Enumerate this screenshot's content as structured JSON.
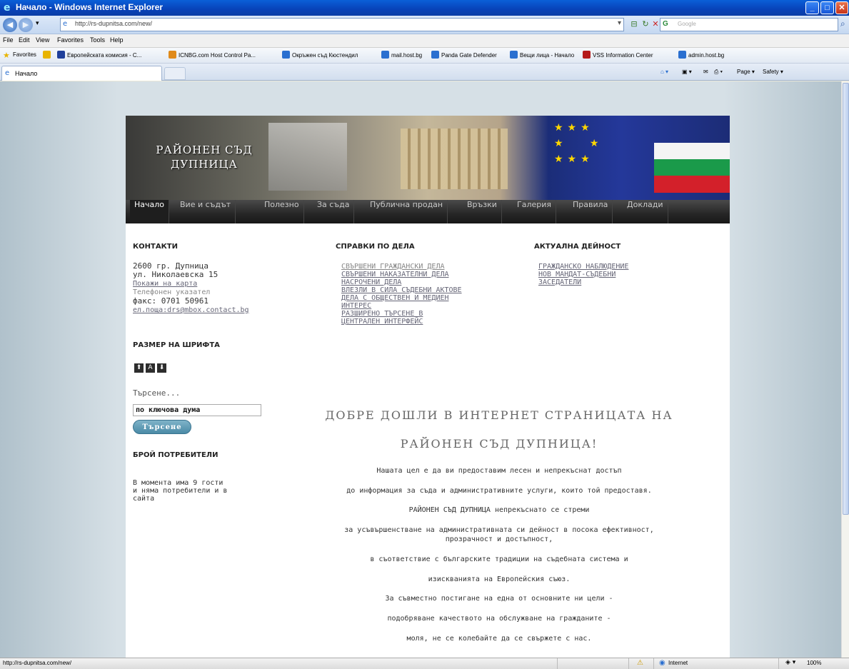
{
  "window": {
    "title": "Начало - Windows Internet Explorer",
    "buttons": {
      "minimize": "_",
      "maximize": "□",
      "close": "✕"
    }
  },
  "addressbar": {
    "url": "http://rs-dupnitsa.com/new/",
    "search_placeholder": "Google",
    "search_logo": "G"
  },
  "menubar": [
    "File",
    "Edit",
    "View",
    "Favorites",
    "Tools",
    "Help"
  ],
  "favoritesbar": {
    "label": "Favorites",
    "items": [
      {
        "label": "Европейската комисия - С...",
        "icon_color": "#1f3f9a"
      },
      {
        "label": "ICNBG.com Host Control Pa...",
        "icon_color": "#e08a1a"
      },
      {
        "label": "Окръжен съд Кюстендил",
        "icon_color": "#2a6fd0"
      },
      {
        "label": "mail.host.bg",
        "icon_color": "#2a6fd0"
      },
      {
        "label": "Panda Gate Defender",
        "icon_color": "#2a6fd0"
      },
      {
        "label": "Вещи лица - Начало",
        "icon_color": "#2a6fd0"
      },
      {
        "label": "VSS Information Center",
        "icon_color": "#b51a1a"
      },
      {
        "label": "admin.host.bg",
        "icon_color": "#2a6fd0"
      }
    ]
  },
  "tabs": {
    "active": "Начало",
    "commands": [
      "Page ▾",
      "Safety ▾"
    ]
  },
  "site": {
    "court_title": "РАЙОНЕН СЪД ДУПНИЦА",
    "nav": [
      "Начало",
      "Вие и съдът",
      "Полезно",
      "За съда",
      "Публична продан",
      "Връзки",
      "Галерия",
      "Правила",
      "Доклади"
    ],
    "contacts": {
      "heading": "КОНТАКТИ",
      "lines": [
        "2600 гр. Дупница",
        "ул. Николаевска 15"
      ],
      "map_link": "Покажи на карта",
      "phone_link": "Телефонен указател",
      "fax": "факс: 0701 50961",
      "email": "ел.поща:drs@mbox.contact.bg"
    },
    "font_size": {
      "heading": "РАЗМЕР НА ШРИФТА",
      "buttons": [
        "⬆",
        "A",
        "⬇"
      ]
    },
    "search": {
      "label": "Търсене...",
      "value": "по ключова дума",
      "button": "Търсене"
    },
    "users": {
      "heading": "БРОЙ ПОТРЕБИТЕЛИ",
      "lines": [
        "В момента има 9  гости",
        "и няма потребители и в",
        "сайта"
      ]
    },
    "cases": {
      "heading": "СПРАВКИ ПО ДЕЛА",
      "links": [
        "СВЪРШЕНИ ГРАЖДАНСКИ ДЕЛА",
        "СВЪРШЕНИ НАКАЗАТЕЛНИ ДЕЛА",
        "НАСРОЧЕНИ ДЕЛА",
        "ВЛЕЗЛИ В СИЛА СЪДЕБНИ АКТОВЕ",
        "ДЕЛА С ОБЩЕСТВЕН И МЕДИЕН",
        "ИНТЕРЕС",
        "РАЗШИРЕНО ТЪРСЕНЕ В",
        "ЦЕНТРАЛЕН ИНТЕРФЕЙС"
      ]
    },
    "activity": {
      "heading": "АКТУАЛНА ДЕЙНОСТ",
      "links": [
        "ГРАЖДАНСКО НАБЛЮДЕНИЕ",
        "НОВ МАНДАТ-СЪДЕБНИ",
        "ЗАСЕДАТЕЛИ"
      ]
    },
    "welcome": {
      "line1": "ДОБРЕ ДОШЛИ В ИНТЕРНЕТ СТРАНИЦАТА НА",
      "line2": "РАЙОНЕН СЪД ДУПНИЦА!",
      "paragraphs": [
        "Нашата цел е да ви предоставим лесен и непрекъснат достъп",
        "до информация за  съда и административните услуги, които той предоставя.",
        "РАЙОНЕН СЪД ДУПНИЦА непрекъснато се стреми",
        "за усъвършенстване на административната си дейност в посока ефективност,",
        "прозрачност и достъпност,",
        "в съответствие с българските традиции на съдебната система и",
        "изискванията на Европейския съюз.",
        "За съвместно постигане на една от основните ни цели -",
        "подобряване  качеството на обслужване на гражданите -",
        "моля, не се колебайте да се свържете с нас."
      ]
    }
  },
  "statusbar": {
    "url": "http://rs-dupnitsa.com/new/",
    "zone": "Internet",
    "zoom": "100%"
  }
}
